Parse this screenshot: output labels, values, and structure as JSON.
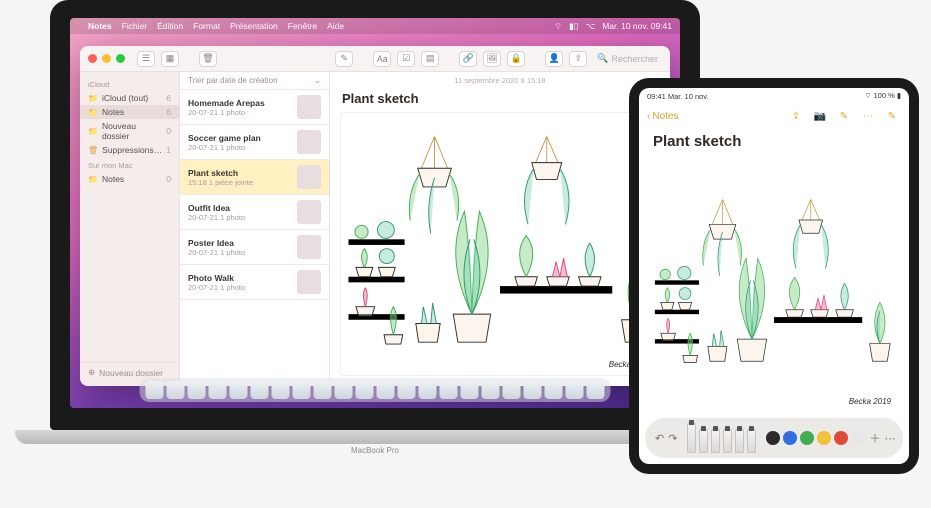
{
  "mac": {
    "model_label": "MacBook Pro",
    "menubar": {
      "app": "Notes",
      "items": [
        "Fichier",
        "Édition",
        "Format",
        "Présentation",
        "Fenêtre",
        "Aide"
      ],
      "clock": "Mar. 10 nov.  09:41"
    },
    "toolbar": {
      "search_placeholder": "Rechercher"
    },
    "sidebar": {
      "section1": "iCloud",
      "section2": "Sur mon Mac",
      "items_icloud": [
        {
          "label": "iCloud (tout)",
          "count": "6"
        },
        {
          "label": "Notes",
          "count": "6",
          "selected": true
        },
        {
          "label": "Nouveau dossier",
          "count": "0"
        },
        {
          "label": "Suppressions récentes",
          "count": "1"
        }
      ],
      "items_local": [
        {
          "label": "Notes",
          "count": "0"
        }
      ],
      "new_folder": "Nouveau dossier"
    },
    "note_list": {
      "sort_label": "Trier par date de création",
      "rows": [
        {
          "title": "Homemade Arepas",
          "sub": "20-07-21  1 photo"
        },
        {
          "title": "Soccer game plan",
          "sub": "20-07-21  1 photo"
        },
        {
          "title": "Plant sketch",
          "sub": "15:18  1 pièce jointe",
          "selected": true
        },
        {
          "title": "Outfit Idea",
          "sub": "20-07-21  1 photo"
        },
        {
          "title": "Poster Idea",
          "sub": "20-07-21  1 photo"
        },
        {
          "title": "Photo Walk",
          "sub": "20-07-21  1 photo"
        }
      ]
    },
    "detail": {
      "date": "11 septembre 2020 à 15:18",
      "title": "Plant sketch",
      "signature": "Becka 2019"
    }
  },
  "ipad": {
    "status_time": "09:41  Mar. 10 nov.",
    "status_batt": "100 %",
    "back_label": "Notes",
    "title": "Plant sketch",
    "signature": "Becka 2019",
    "markup": {
      "color_swatches": [
        "#2a2a2a",
        "#2f6fe0",
        "#3fae4e",
        "#f2c23a",
        "#e04a3a",
        "#e7e7e7"
      ]
    }
  }
}
